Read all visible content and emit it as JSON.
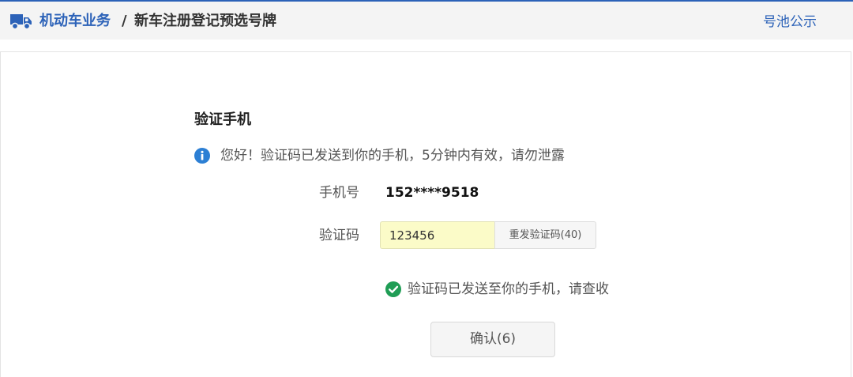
{
  "header": {
    "section": "机动车业务",
    "separator": "/",
    "page_title": "新车注册登记预选号牌",
    "pool_link": "号池公示"
  },
  "verify": {
    "title": "验证手机",
    "notice": "您好！验证码已发送到你的手机，5分钟内有效，请勿泄露",
    "phone_label": "手机号",
    "phone_value": "152****9518",
    "code_label": "验证码",
    "code_value": "123456",
    "resend_label": "重发验证码(40)",
    "success_message": "验证码已发送至你的手机，请查收",
    "confirm_label": "确认(6)"
  },
  "colors": {
    "brand_blue": "#2c62b8",
    "input_highlight": "#fbfbc8",
    "success_green": "#1f9d55"
  },
  "icons": {
    "header": "truck-icon",
    "notice": "info-icon",
    "success": "check-circle-icon"
  }
}
